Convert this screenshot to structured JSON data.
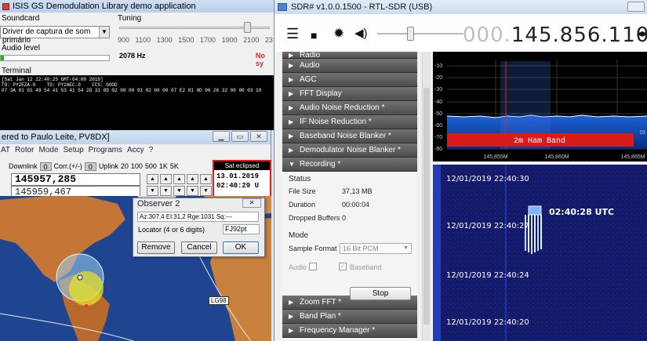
{
  "isis": {
    "title": "ISIS GS Demodulation Library demo application",
    "soundcard_label": "Soundcard",
    "soundcard_value": "Driver de captura de som primário",
    "audio_level_label": "Audio level",
    "audio_level": 0.03,
    "tuning_label": "Tuning",
    "tuning_ticks": [
      "900",
      "1100",
      "1300",
      "1500",
      "1700",
      "1900",
      "2100",
      "23"
    ],
    "tuning_hz": "2078 Hz",
    "sync_status": "No sy",
    "terminal_label": "Terminal",
    "terminal_lines": [
      "[Sat Jan 12 22:40:25 GMT-04:00 2019]",
      "TO: PY2EZA-0    TO: PY2AEC-0    FCS: GOOD",
      "07 3A 01 01 49 54 41 53 41 54 2D 31 8D 02 00 00 91 02 00 00 07 E2 01 0D 00 26 32 00 00 03 10"
    ]
  },
  "pv": {
    "title": "ered to Paulo Leite, PV8DX]",
    "menu": [
      "AT",
      "Rotor",
      "Mode",
      "Setup",
      "Programs",
      "Accy",
      "?"
    ],
    "downlink_label": "Downlink",
    "downlink_value": "0",
    "corr_label": "Corr.(+/-)",
    "corr_value": "0",
    "uplink_label": "Uplink",
    "steps": [
      "20",
      "100",
      "500",
      "1K",
      "5K"
    ],
    "freq_downlink": "145957,285",
    "freq_uplink": "145959,467",
    "sat_status": "Sat eclipsed",
    "sat_date": "13.01.2019",
    "sat_time": "02:40:29 U"
  },
  "observer": {
    "title": "Observer 2",
    "close_glyph": "✕",
    "info": "Az:307,4 El:31,2 Rge:1031 Sq:---",
    "locator_label": "Locator (4 or 6 digits)",
    "locator_value": "FJ92pt",
    "remove_label": "Remove",
    "cancel_label": "Cancel",
    "ok_label": "OK",
    "map_label": "LG98"
  },
  "sdr": {
    "title": "SDR# v1.0.0.1500 - RTL-SDR (USB)",
    "freq_dim": "000.",
    "freq_main": "145.856.110",
    "freq_arrows": "◂▸",
    "accordion_top": [
      "Radio",
      "Audio",
      "AGC",
      "FFT Display",
      "Audio Noise Reduction *",
      "IF Noise Reduction *",
      "Baseband Noise Blanker *",
      "Demodulator Noise Blanker *",
      "Recording *"
    ],
    "accordion_bottom": [
      "Zoom FFT *",
      "Band Plan *",
      "Frequency Manager *"
    ],
    "recording": {
      "status_label": "Status",
      "file_size_label": "File Size",
      "file_size_value": "37,13 MB",
      "duration_label": "Duration",
      "duration_value": "00:00:04",
      "dropped_label": "Dropped Buffers",
      "dropped_value": "0",
      "mode_label": "Mode",
      "sample_format_label": "Sample Format",
      "sample_format_value": "16 Bit PCM",
      "audio_label": "Audio",
      "baseband_label": "Baseband",
      "stop_label": "Stop"
    },
    "spectrum": {
      "y_ticks": [
        "-10",
        "-20",
        "-30",
        "-40",
        "-50",
        "-60",
        "-70",
        "-80"
      ],
      "x_ticks": [
        "145,855M",
        "145,860M",
        "145,865M"
      ],
      "band_label": "2m Ham Band",
      "right_label": "15"
    },
    "waterfall": {
      "timestamps": [
        "12/01/2019 22:40:30",
        "12/01/2019 22:40:27",
        "12/01/2019 22:40:24",
        "12/01/2019 22:40:20"
      ],
      "utc_label": "02:40:28 UTC"
    }
  }
}
